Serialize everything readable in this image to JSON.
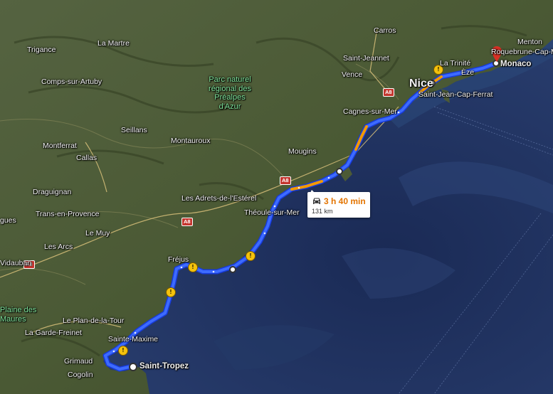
{
  "map": {
    "colors": {
      "route": "#2f5cff",
      "traffic": "#f29900",
      "water": "#1d2e56",
      "land": "#4c5a36",
      "destination_pin": "#d93025"
    },
    "places": {
      "monaco": "Monaco",
      "saint_tropez": "Saint-Tropez",
      "nice": "Nice",
      "roquebrune": "Roquebrune-Cap-Martin",
      "menton": "Menton",
      "carros": "Carros",
      "saint_jeannet": "Saint-Jeannet",
      "vence": "Vence",
      "trinite": "La Trinité",
      "eze": "Èze",
      "saint_jean": "Saint-Jean-Cap-Ferrat",
      "cagnes": "Cagnes-sur-Mer",
      "mougins": "Mougins",
      "theoule": "Théoule-sur-Mer",
      "adrets": "Les Adrets-de-l'Estérel",
      "montauroux": "Montauroux",
      "seillans": "Seillans",
      "callas": "Callas",
      "montferrat": "Montferrat",
      "draguignan": "Draguignan",
      "trans": "Trans-en-Provence",
      "le_muy": "Le Muy",
      "les_arcs": "Les Arcs",
      "vidauban": "Vidauban",
      "frejus": "Fréjus",
      "plan_de_la_tour": "Le Plan-de-la-Tour",
      "sainte_maxime": "Sainte-Maxime",
      "garde_freinet": "La Garde-Freinet",
      "grimaud": "Grimaud",
      "cogolin": "Cogolin",
      "plaine_des_maures_1": "Plaine des",
      "plaine_des_maures_2": "Maures",
      "trigance": "Trigance",
      "la_martre": "La Martre",
      "comps": "Comps-sur-Artuby",
      "gues": "gues",
      "park_1": "Parc naturel",
      "park_2": "régional des",
      "park_3": "Préalpes",
      "park_4": "d'Azur"
    },
    "road_shields": [
      "A8",
      "A8",
      "A8",
      "A8"
    ],
    "route": {
      "duration": "3 h 40 min",
      "distance": "131 km",
      "mode_icon": "car-icon"
    }
  }
}
